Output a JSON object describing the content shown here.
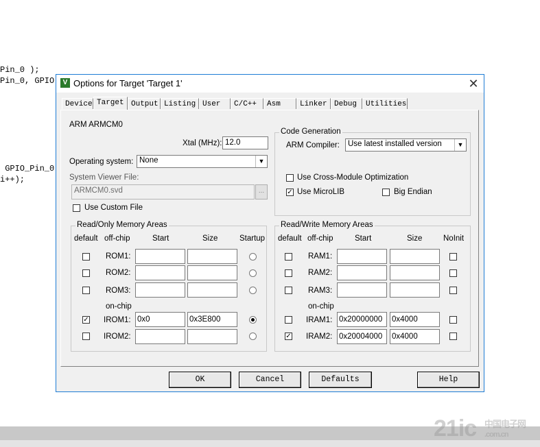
{
  "background_code": {
    "line1": "Pin_0 );",
    "line2": "Pin_0, GPIO",
    "line3": " GPIO_Pin_0",
    "line4": "i++);"
  },
  "watermark": {
    "big": "21ic",
    "small": "中国电子网",
    "sub": ".com.cn"
  },
  "dialog": {
    "title": "Options for Target 'Target 1'",
    "close": "✕",
    "app_icon": "V",
    "tabs": [
      "Device",
      "Target",
      "Output",
      "Listing",
      "User",
      "C/C++",
      "Asm",
      "Linker",
      "Debug",
      "Utilities"
    ],
    "active_tab": "Target",
    "device_name": "ARM ARMCM0",
    "xtal_label": "Xtal (MHz):",
    "xtal_value": "12.0",
    "os_label": "Operating system:",
    "os_value": "None",
    "svf_label": "System Viewer File:",
    "svf_value": "ARMCM0.svd",
    "browse_label": "...",
    "custom_file_label": "Use Custom File",
    "code_gen": {
      "legend": "Code Generation",
      "compiler_label": "ARM Compiler:",
      "compiler_value": "Use latest installed version",
      "cross_module_label": "Use Cross-Module Optimization",
      "microlib_label": "Use MicroLIB",
      "big_endian_label": "Big Endian"
    },
    "rom": {
      "legend": "Read/Only Memory Areas",
      "headers": {
        "default": "default",
        "offchip": "off-chip",
        "start": "Start",
        "size": "Size",
        "startup": "Startup"
      },
      "onchip_label": "on-chip",
      "rows": [
        {
          "label": "ROM1:",
          "start": "",
          "size": ""
        },
        {
          "label": "ROM2:",
          "start": "",
          "size": ""
        },
        {
          "label": "ROM3:",
          "start": "",
          "size": ""
        },
        {
          "label": "IROM1:",
          "start": "0x0",
          "size": "0x3E800"
        },
        {
          "label": "IROM2:",
          "start": "",
          "size": ""
        }
      ]
    },
    "ram": {
      "legend": "Read/Write Memory Areas",
      "headers": {
        "default": "default",
        "offchip": "off-chip",
        "start": "Start",
        "size": "Size",
        "noinit": "NoInit"
      },
      "onchip_label": "on-chip",
      "rows": [
        {
          "label": "RAM1:",
          "start": "",
          "size": ""
        },
        {
          "label": "RAM2:",
          "start": "",
          "size": ""
        },
        {
          "label": "RAM3:",
          "start": "",
          "size": ""
        },
        {
          "label": "IRAM1:",
          "start": "0x20000000",
          "size": "0x4000"
        },
        {
          "label": "IRAM2:",
          "start": "0x20004000",
          "size": "0x4000"
        }
      ]
    },
    "buttons": {
      "ok": "OK",
      "cancel": "Cancel",
      "defaults": "Defaults",
      "help": "Help"
    }
  }
}
